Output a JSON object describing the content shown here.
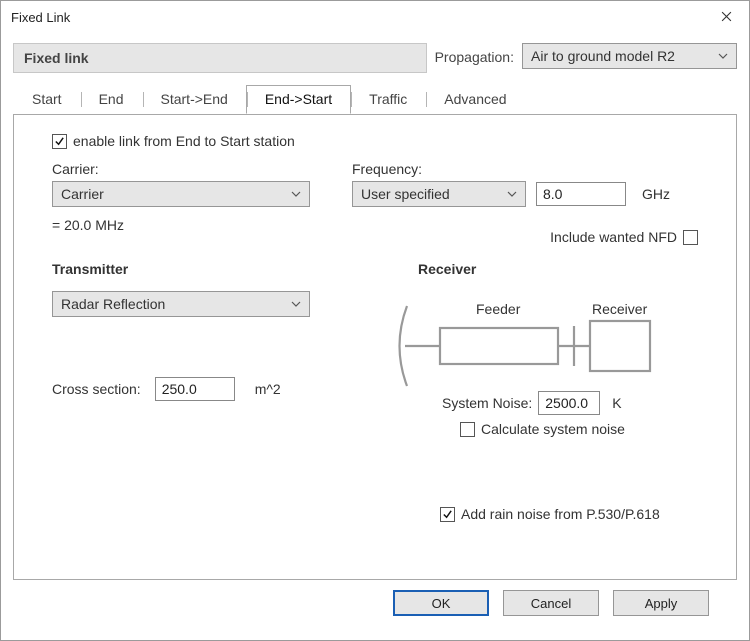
{
  "window": {
    "title": "Fixed Link"
  },
  "header": {
    "section_title": "Fixed link",
    "propagation_label": "Propagation:",
    "propagation_value": "Air to ground model R2"
  },
  "tabs": {
    "items": [
      "Start",
      "End",
      "Start->End",
      "End->Start",
      "Traffic",
      "Advanced"
    ],
    "active": 3
  },
  "panel": {
    "enable_label": "enable link from End to Start station",
    "enable_checked": true,
    "carrier_label": "Carrier:",
    "carrier_value": "Carrier",
    "carrier_info": "= 20.0 MHz",
    "frequency_label": "Frequency:",
    "frequency_mode": "User specified",
    "frequency_value": "8.0",
    "frequency_unit": "GHz",
    "nfd_label": "Include wanted NFD",
    "nfd_checked": false,
    "tx_title": "Transmitter",
    "tx_value": "Radar Reflection",
    "cross_label": "Cross section:",
    "cross_value": "250.0",
    "cross_unit": "m^2",
    "rx_title": "Receiver",
    "diagram": {
      "feeder_label": "Feeder",
      "receiver_label": "Receiver"
    },
    "sysnoise_label": "System Noise:",
    "sysnoise_value": "2500.0",
    "sysnoise_unit": "K",
    "calc_noise_label": "Calculate system noise",
    "calc_noise_checked": false,
    "rain_label": "Add rain noise from P.530/P.618",
    "rain_checked": true
  },
  "buttons": {
    "ok": "OK",
    "cancel": "Cancel",
    "apply": "Apply"
  }
}
